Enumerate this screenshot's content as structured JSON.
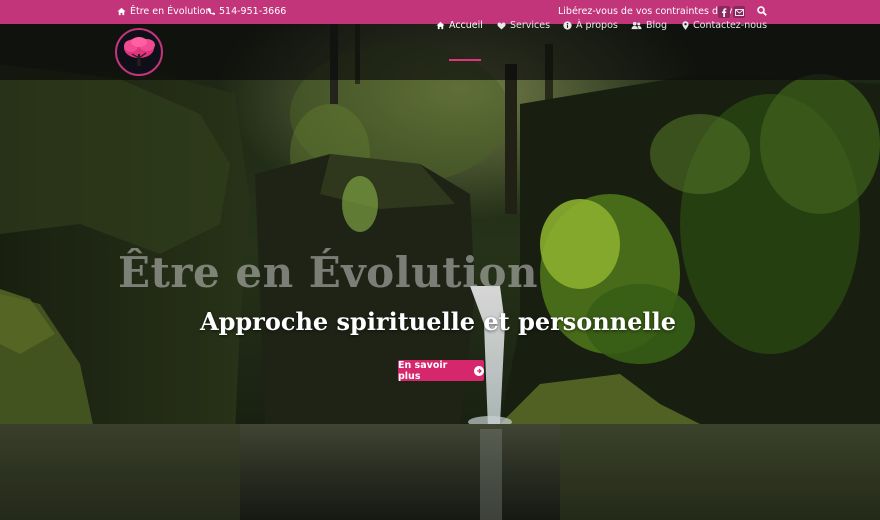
{
  "topbar": {
    "site_name": "Être en Évolution",
    "phone": "514-951-3666",
    "slogan": "Libérez-vous de vos contraintes de vie!",
    "bg_color": "#c2357a",
    "icons": [
      "home-icon",
      "phone-icon",
      "facebook-icon",
      "email-icon",
      "search-icon"
    ]
  },
  "nav": {
    "items": [
      {
        "label": "Accueil",
        "icon": "home-icon",
        "active": true
      },
      {
        "label": "Services",
        "icon": "heart-icon"
      },
      {
        "label": "À propos",
        "icon": "info-icon"
      },
      {
        "label": "Blog",
        "icon": "users-icon"
      },
      {
        "label": "Contactez-nous",
        "icon": "location-pin-icon"
      }
    ],
    "active_color": "#e0357e"
  },
  "hero": {
    "title": "Être en Évolution",
    "subtitle": "Approche spirituelle et personnelle",
    "cta_label": "En savoir plus",
    "cta_color": "#d6266c"
  }
}
